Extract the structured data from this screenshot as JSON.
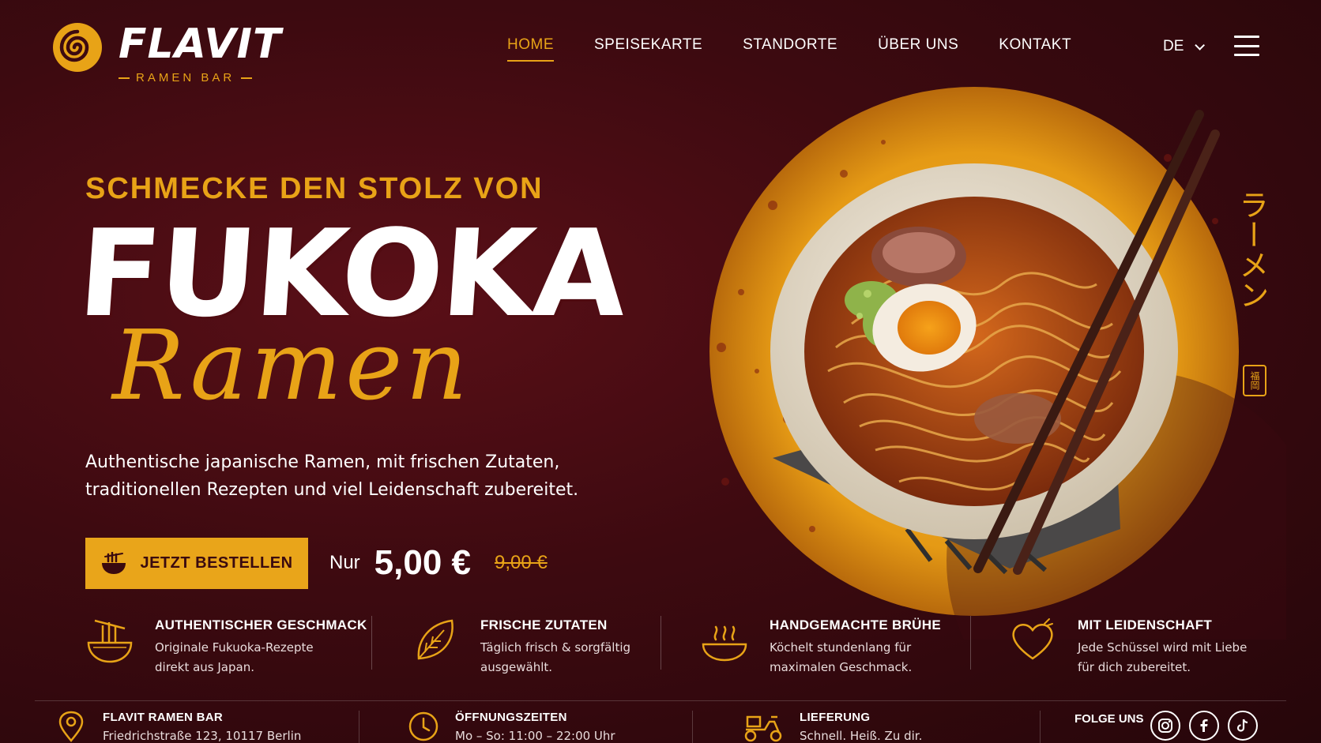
{
  "brand": {
    "name": "FLAVIT",
    "tagline": "RAMEN BAR"
  },
  "nav": {
    "items": [
      {
        "label": "HOME",
        "active": true
      },
      {
        "label": "SPEISEKARTE",
        "active": false
      },
      {
        "label": "STANDORTE",
        "active": false
      },
      {
        "label": "ÜBER UNS",
        "active": false
      },
      {
        "label": "KONTAKT",
        "active": false
      }
    ],
    "language": "DE"
  },
  "hero": {
    "kicker": "SCHMECKE DEN STOLZ VON",
    "headline": "FUKOKA",
    "script": "Ramen",
    "description": "Authentische japanische Ramen, mit frischen Zutaten, traditionellen Rezepten und viel Leidenschaft zubereitet.",
    "cta_label": "JETZT BESTELLEN",
    "price_prefix": "Nur",
    "price_now": "5,00 €",
    "price_old": "9,00 €",
    "vertical_text": "ラーメン",
    "stamp_text": "福岡"
  },
  "features": [
    {
      "title": "AUTHENTISCHER GESCHMACK",
      "text": "Originale Fukuoka-Rezepte direkt aus Japan.",
      "icon": "noodle-bowl-icon"
    },
    {
      "title": "FRISCHE ZUTATEN",
      "text": "Täglich frisch & sorgfältig ausgewählt.",
      "icon": "leaf-icon"
    },
    {
      "title": "HANDGEMACHTE BRÜHE",
      "text": "Köchelt stundenlang für maximalen Geschmack.",
      "icon": "steaming-bowl-icon"
    },
    {
      "title": "MIT LEIDENSCHAFT",
      "text": "Jede Schüssel wird mit Liebe für dich zubereitet.",
      "icon": "heart-icon"
    }
  ],
  "info": {
    "location_title": "FLAVIT RAMEN BAR",
    "location_text": "Friedrichstraße 123, 10117 Berlin",
    "hours_title": "ÖFFNUNGSZEITEN",
    "hours_text": "Mo – So: 11:00 – 22:00 Uhr",
    "delivery_title": "LIEFERUNG",
    "delivery_text": "Schnell. Heiß. Zu dir.",
    "social_title": "FOLGE UNS",
    "socials": [
      "instagram-icon",
      "facebook-icon",
      "tiktok-icon"
    ]
  },
  "colors": {
    "accent": "#e8a317",
    "background": "#3d0a10",
    "text": "#ffffff"
  }
}
